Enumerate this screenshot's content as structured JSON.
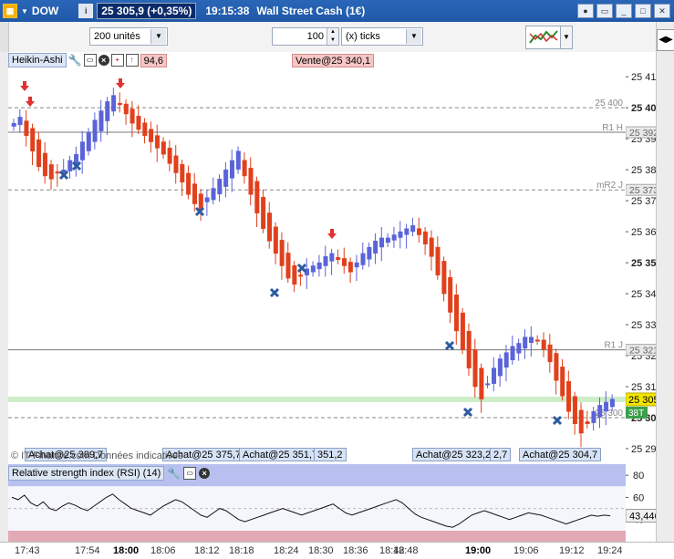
{
  "titlebar": {
    "symbol": "DOW",
    "price_change": "25 305,9 (+0,35%)",
    "time": "19:15:38",
    "instrument": "Wall Street Cash (1€)"
  },
  "toolbar": {
    "units_value": "200 unités",
    "ticks_value": "100",
    "ticks_unit": "(x) ticks"
  },
  "chart": {
    "indicator_name": "Heikin-Ashi",
    "header_price_fragment": "94,6",
    "sell_order": "Vente@25 340,1",
    "buy_orders": [
      "Achat@25 389,7",
      "Achat@25 375,7",
      "Achat@25 351,7",
      "351,2",
      "Achat@25 323,2",
      "2,7",
      "Achat@25 304,7"
    ],
    "watermark": "© IT-Finance.com Données indicatives",
    "levels": [
      {
        "name": "25 400",
        "label": "",
        "value": 25400
      },
      {
        "name": "R1 H",
        "label": "25 392,1",
        "value": 25392.1
      },
      {
        "name": "mR2 J",
        "label": "25 373,5",
        "value": 25373.5
      },
      {
        "name": "R1 J",
        "label": "25 321,9",
        "value": 25321.9
      },
      {
        "name": "25 300",
        "label": "",
        "value": 25300
      }
    ],
    "current_price": "25 305,9",
    "ticks_badge": "38T",
    "price_ticks": [
      "25 410",
      "25 400",
      "25 390",
      "25 380",
      "25 370",
      "25 360",
      "25 350",
      "25 340",
      "25 330",
      "25 320",
      "25 310",
      "25 300",
      "25 290"
    ],
    "bold_ticks": [
      "25 400",
      "25 350",
      "25 300"
    ]
  },
  "rsi": {
    "title": "Relative strength index (RSI) (14)",
    "current": "43,446",
    "ticks": [
      "80",
      "60",
      "40"
    ],
    "upper_band": 70,
    "lower_band": 30
  },
  "time_axis": {
    "labels": [
      "17:43",
      "17:54",
      "18:00",
      "18:06",
      "18:12",
      "18:18",
      "18:24",
      "18:30",
      "18:36",
      "18:42",
      "18:48",
      "19:00",
      "19:06",
      "19:12",
      "19:24"
    ],
    "bold": [
      "18:00",
      "19:00"
    ]
  },
  "colors": {
    "bull": "#5a63d8",
    "bear": "#e0401c",
    "marker": "#2c5aa0",
    "arrow": "#e03030",
    "rsi_high": "#b7c0ef",
    "rsi_low": "#e3a9b6"
  },
  "chart_data": {
    "type": "candlestick",
    "description_series": "Heikin-Ashi",
    "ylim": [
      25285,
      25418
    ],
    "close_series": [
      25395,
      25397,
      25391,
      25386,
      25381,
      25378,
      25377,
      25379,
      25380,
      25383,
      25385,
      25389,
      25392,
      25396,
      25399,
      25402,
      25404,
      25401,
      25398,
      25395,
      25393,
      25391,
      25389,
      25387,
      25385,
      25382,
      25379,
      25376,
      25372,
      25369,
      25367,
      25371,
      25374,
      25377,
      25380,
      25383,
      25386,
      25378,
      25372,
      25366,
      25361,
      25357,
      25353,
      25349,
      25345,
      25343,
      25346,
      25348,
      25349,
      25350,
      25352,
      25353,
      25351,
      25349,
      25347,
      25350,
      25353,
      25355,
      25357,
      25358,
      25358,
      25359,
      25360,
      25361,
      25362,
      25359,
      25356,
      25352,
      25346,
      25340,
      25334,
      25328,
      25322,
      25316,
      25310,
      25306,
      25311,
      25316,
      25319,
      25321,
      25323,
      25324,
      25326,
      25326,
      25325,
      25322,
      25318,
      25312,
      25307,
      25302,
      25298,
      25295,
      25298,
      25302,
      25304,
      25305,
      25306
    ]
  }
}
